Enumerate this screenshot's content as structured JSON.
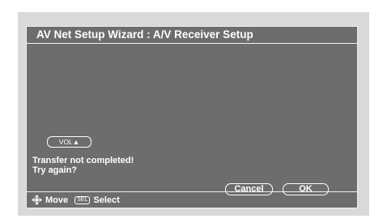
{
  "dialog": {
    "title": "AV Net Setup Wizard : A/V Receiver Setup",
    "vol_button_label": "VOL▲",
    "message_line1": "Transfer not completed!",
    "message_line2": "Try again?",
    "cancel_label": "Cancel",
    "ok_label": "OK"
  },
  "footer": {
    "move_icon": "directional-pad-icon",
    "move_label": "Move",
    "sel_key_label": "SEL",
    "select_label": "Select"
  },
  "colors": {
    "panel_background": "#6d6d6d",
    "screen_background": "#d9d9d9",
    "text": "#ffffff"
  }
}
